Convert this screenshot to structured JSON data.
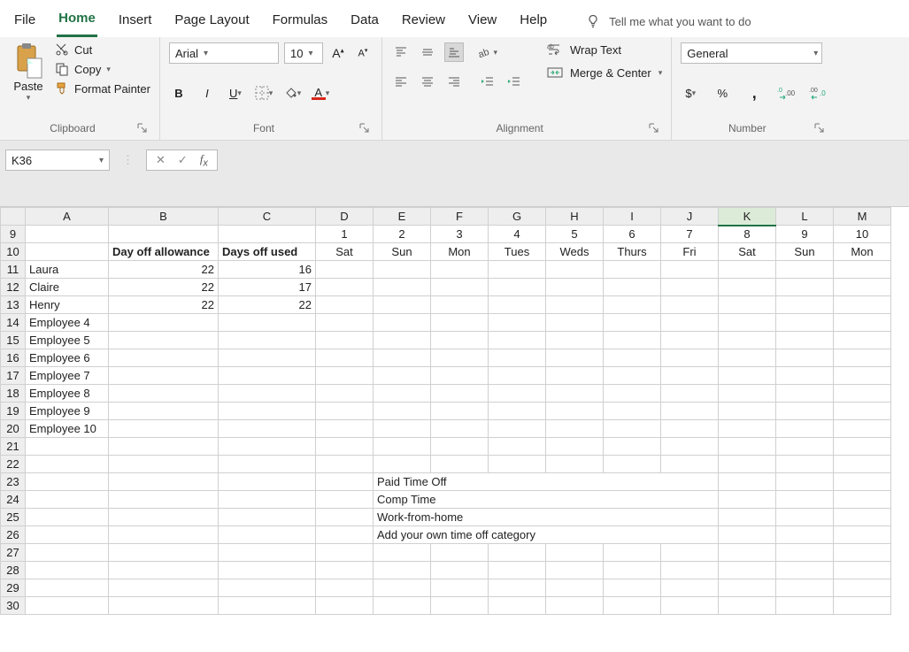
{
  "menu": {
    "items": [
      "File",
      "Home",
      "Insert",
      "Page Layout",
      "Formulas",
      "Data",
      "Review",
      "View",
      "Help"
    ],
    "active": "Home",
    "tellme": "Tell me what you want to do"
  },
  "ribbon": {
    "clipboard": {
      "paste": "Paste",
      "cut": "Cut",
      "copy": "Copy",
      "format_painter": "Format Painter",
      "label": "Clipboard"
    },
    "font": {
      "name": "Arial",
      "size": "10",
      "label": "Font"
    },
    "alignment": {
      "wrap": "Wrap Text",
      "merge": "Merge & Center",
      "label": "Alignment"
    },
    "number": {
      "format": "General",
      "label": "Number"
    }
  },
  "formula_bar": {
    "namebox": "K36",
    "value": ""
  },
  "sheet": {
    "columns": [
      "A",
      "B",
      "C",
      "D",
      "E",
      "F",
      "G",
      "H",
      "I",
      "J",
      "K",
      "L",
      "M"
    ],
    "selected_col": "K",
    "row_start": 9,
    "row_end": 30,
    "row9": {
      "nums": [
        "1",
        "2",
        "3",
        "4",
        "5",
        "6",
        "7",
        "8",
        "9",
        "10"
      ]
    },
    "row10": {
      "B": "Day off allowance",
      "C": "Days off used",
      "days": [
        "Sat",
        "Sun",
        "Mon",
        "Tues",
        "Weds",
        "Thurs",
        "Fri",
        "Sat",
        "Sun",
        "Mon"
      ]
    },
    "employees": [
      {
        "name": "Laura",
        "allow": "22",
        "used": "16",
        "pto": [
          "I",
          "J"
        ],
        "wfh": []
      },
      {
        "name": "Claire",
        "allow": "22",
        "used": "17",
        "pto": [],
        "wfh": []
      },
      {
        "name": "Henry",
        "allow": "22",
        "used": "22",
        "pto": [],
        "wfh": [
          "F",
          "G",
          "H",
          "I",
          "J"
        ]
      },
      {
        "name": "Employee 4",
        "allow": "",
        "used": "",
        "pto": [],
        "wfh": []
      },
      {
        "name": "Employee 5",
        "allow": "",
        "used": "",
        "pto": [],
        "wfh": []
      },
      {
        "name": "Employee 6",
        "allow": "",
        "used": "",
        "pto": [],
        "wfh": []
      },
      {
        "name": "Employee 7",
        "allow": "",
        "used": "",
        "pto": [],
        "wfh": []
      },
      {
        "name": "Employee 8",
        "allow": "",
        "used": "",
        "pto": [],
        "wfh": []
      },
      {
        "name": "Employee 9",
        "allow": "",
        "used": "",
        "pto": [],
        "wfh": []
      },
      {
        "name": "Employee 10",
        "allow": "",
        "used": "",
        "pto": [],
        "wfh": []
      }
    ],
    "legend": [
      {
        "cls": "pto",
        "label": "Paid Time Off"
      },
      {
        "cls": "comp",
        "label": "Comp Time"
      },
      {
        "cls": "wfh",
        "label": "Work-from-home"
      },
      {
        "cls": "own",
        "label": "Add your own time off category"
      }
    ],
    "weekend_cols": [
      "D",
      "E",
      "K",
      "L"
    ]
  }
}
